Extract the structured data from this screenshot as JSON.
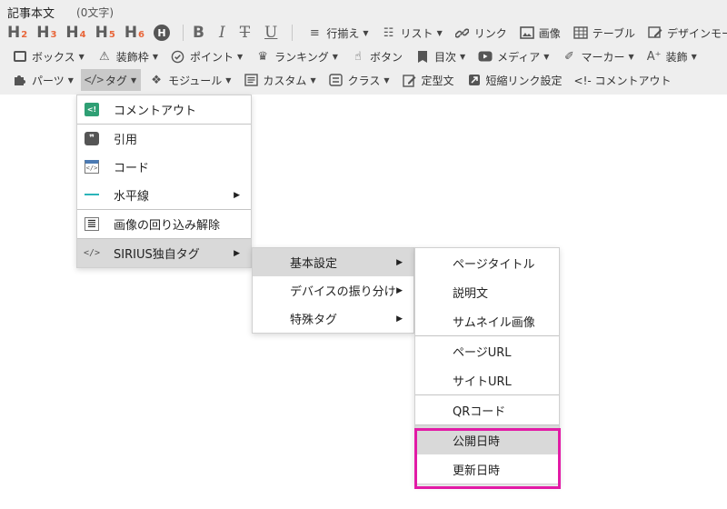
{
  "header": {
    "title": "記事本文",
    "char_count": "(0文字)"
  },
  "toolbar": {
    "headings": [
      {
        "main": "H",
        "sub": "2"
      },
      {
        "main": "H",
        "sub": "3"
      },
      {
        "main": "H",
        "sub": "4"
      },
      {
        "main": "H",
        "sub": "5"
      },
      {
        "main": "H",
        "sub": "6"
      }
    ],
    "h_circle": "H",
    "format": {
      "bold": "B",
      "italic": "I",
      "strike": "T",
      "underline": "U"
    },
    "row1": [
      {
        "label": "行揃え",
        "icon": "align-left-icon",
        "glyph": "≡",
        "dropdown": true
      },
      {
        "label": "リスト",
        "icon": "list-icon",
        "glyph": "☷",
        "dropdown": true
      },
      {
        "label": "リンク",
        "icon": "link-icon",
        "glyph": "🔗",
        "dropdown": false
      },
      {
        "label": "画像",
        "icon": "image-icon",
        "glyph": "▣",
        "dropdown": false
      },
      {
        "label": "テーブル",
        "icon": "table-icon",
        "glyph": "▦",
        "dropdown": false
      },
      {
        "label": "デザインモード",
        "icon": "design-mode-icon",
        "glyph": "✎",
        "dropdown": false
      }
    ],
    "row2": [
      {
        "label": "ボックス",
        "icon": "box-icon",
        "glyph": "▭",
        "dropdown": true
      },
      {
        "label": "装飾枠",
        "icon": "warning-icon",
        "glyph": "⚠",
        "dropdown": true
      },
      {
        "label": "ポイント",
        "icon": "check-circle-icon",
        "glyph": "✔",
        "dropdown": true
      },
      {
        "label": "ランキング",
        "icon": "crown-icon",
        "glyph": "♛",
        "dropdown": true
      },
      {
        "label": "ボタン",
        "icon": "pointer-icon",
        "glyph": "☝",
        "dropdown": false
      },
      {
        "label": "目次",
        "icon": "bookmark-icon",
        "glyph": "▮",
        "dropdown": true
      },
      {
        "label": "メディア",
        "icon": "youtube-icon",
        "glyph": "▶",
        "dropdown": true
      },
      {
        "label": "マーカー",
        "icon": "marker-icon",
        "glyph": "✐",
        "dropdown": true
      },
      {
        "label": "装飾",
        "icon": "text-plus-icon",
        "glyph": "A⁺",
        "dropdown": true
      }
    ],
    "row3": [
      {
        "label": "パーツ",
        "icon": "puzzle-icon",
        "glyph": "✚",
        "dropdown": true
      },
      {
        "label": "タグ",
        "icon": "code-icon",
        "glyph": "</>",
        "dropdown": true,
        "active": true
      },
      {
        "label": "モジュール",
        "icon": "module-icon",
        "glyph": "❖",
        "dropdown": true
      },
      {
        "label": "カスタム",
        "icon": "custom-icon",
        "glyph": "☰",
        "dropdown": true
      },
      {
        "label": "クラス",
        "icon": "css-icon",
        "glyph": "◫",
        "dropdown": true
      },
      {
        "label": "定型文",
        "icon": "edit-icon",
        "glyph": "✎",
        "dropdown": false
      },
      {
        "label": "短縮リンク設定",
        "icon": "shortlink-icon",
        "glyph": "◩",
        "dropdown": false
      },
      {
        "label": "<!- コメントアウト",
        "icon": "",
        "glyph": "",
        "dropdown": false
      }
    ]
  },
  "tag_menu": [
    {
      "label": "コメントアウト",
      "icon": "comment-out-icon",
      "glyph": "<!"
    },
    {
      "label": "引用",
      "icon": "quote-icon",
      "glyph": "❞"
    },
    {
      "label": "コード",
      "icon": "code-block-icon",
      "glyph": "</>"
    },
    {
      "label": "水平線",
      "icon": "horizontal-line-icon",
      "glyph": "",
      "submenu": true
    },
    {
      "label": "画像の回り込み解除",
      "icon": "clear-float-icon",
      "glyph": "≣"
    },
    {
      "label": "SIRIUS独自タグ",
      "icon": "sirius-tag-icon",
      "glyph": "</>",
      "submenu": true,
      "highlighted": true
    }
  ],
  "sirius_menu": [
    {
      "label": "基本設定",
      "submenu": true,
      "highlighted": true
    },
    {
      "label": "デバイスの振り分け",
      "submenu": true
    },
    {
      "label": "特殊タグ",
      "submenu": true
    }
  ],
  "basic_settings_menu": [
    {
      "label": "ページタイトル"
    },
    {
      "label": "説明文"
    },
    {
      "label": "サムネイル画像"
    },
    {
      "label": "ページURL"
    },
    {
      "label": "サイトURL"
    },
    {
      "label": "QRコード"
    },
    {
      "label": "公開日時",
      "highlighted": true
    },
    {
      "label": "更新日時"
    }
  ],
  "colors": {
    "toolbar_bg": "#eeeeee",
    "active_button": "#c9c9c9",
    "menu_highlight": "#d9d9d9",
    "heading_subscript": "#e8663a",
    "callout_border": "#e21ba6"
  }
}
